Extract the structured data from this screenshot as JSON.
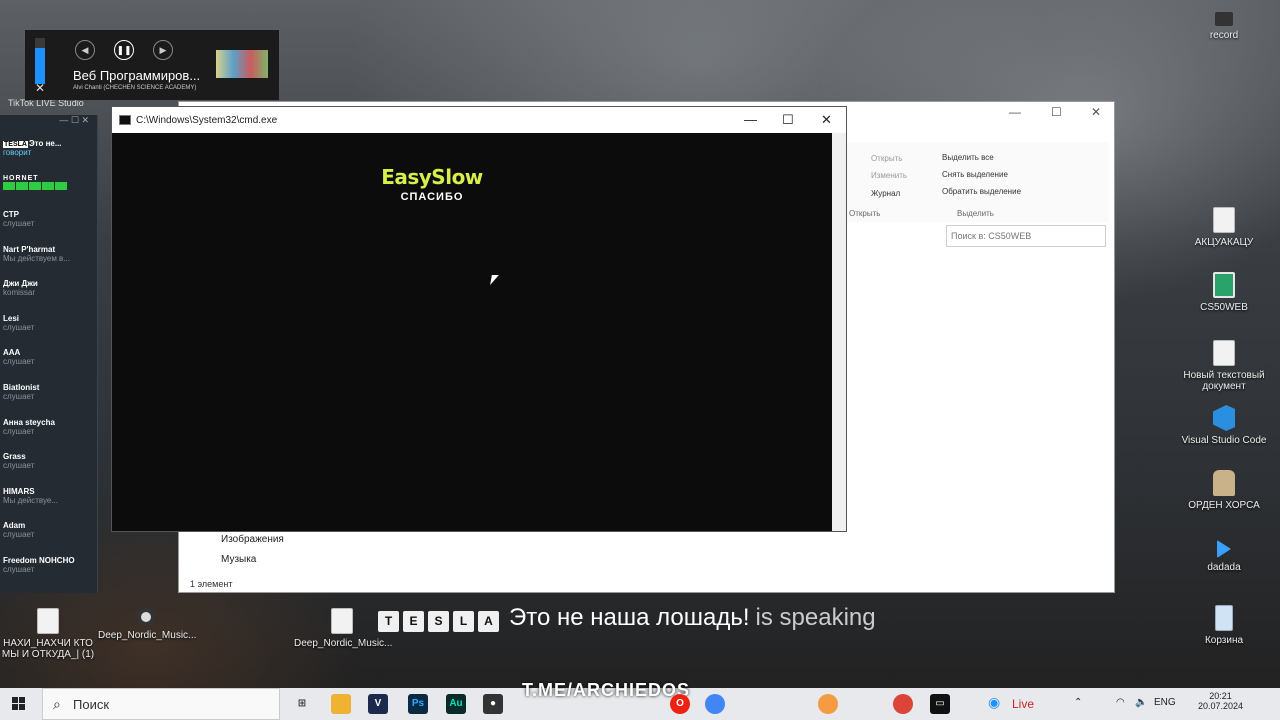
{
  "desktop": {
    "left_icons": [
      {
        "label": "NAXI_NAXCHI  KTO MY I OTKUDA_| (1)",
        "display": "НАХИ_НАХЧИ  КТО МЫ И ОТКУДА_| (1)"
      },
      {
        "label": "Deep_Nordic_Music...",
        "display": "Deep_Nordic_Music..."
      },
      {
        "label": "Deep_Nordic_Music...",
        "display": "Deep_Nordic_Music..."
      }
    ],
    "small_labels": {
      "tiktok": "TikTok LIVE Studio",
      "nakhi_short": "НАХЧИ  НАХЧИ  МЫ И ОТКУДА_"
    },
    "right_icons": [
      {
        "label": "record"
      },
      {
        "label": "АКЦУАКАЦУ"
      },
      {
        "label": "CS50WEB"
      },
      {
        "label": "Новый текстовый документ"
      },
      {
        "label": "Visual Studio Code"
      },
      {
        "label": "ОРДЕН ХОРСА"
      },
      {
        "label": "dadada"
      },
      {
        "label": "Корзина"
      }
    ]
  },
  "media_flyout": {
    "title": "Веб Программиров...",
    "artist": "Alvi Chanti (CHECHEN SCIENCE ACADEMY)",
    "volume_level": 0.78,
    "close_glyph": "✕"
  },
  "voice_panel": {
    "header_controls": "—  ☐  ✕",
    "speaker": {
      "tag_letters": [
        "T",
        "E",
        "S",
        "L",
        "A"
      ],
      "name": "Это не...",
      "status": "говорит"
    },
    "hornet_tag": "HORNET",
    "users": [
      {
        "name": "CTP",
        "status": "слушает"
      },
      {
        "name": "Nart P'harmat",
        "status": "Мы действуем в..."
      },
      {
        "name": "Джи Джи",
        "status": "komissar"
      },
      {
        "name": "Lesi",
        "status": "слушает"
      },
      {
        "name": "AAA",
        "status": "слушает"
      },
      {
        "name": "Biatlonist",
        "status": "слушает"
      },
      {
        "name": "Анна steycha",
        "status": "слушает"
      },
      {
        "name": "Grass",
        "status": "слушает"
      },
      {
        "name": "HIMARS",
        "status": "Мы действуе..."
      },
      {
        "name": "Adam",
        "status": "слушает"
      },
      {
        "name": "Freedom NOHCHO",
        "status": "слушает"
      }
    ]
  },
  "explorer": {
    "ribbon": {
      "open": "Открыть",
      "edit": "Изменить",
      "history": "Журнал",
      "open_group": "Открыть",
      "select_all": "Выделить все",
      "select_none": "Снять выделение",
      "invert": "Обратить выделение",
      "select_group": "Выделить"
    },
    "search_placeholder": "Поиск в: CS50WEB",
    "nav": [
      "Изображения",
      "Музыка"
    ],
    "status": "1 элемент",
    "controls": {
      "min": "—",
      "max": "☐",
      "close": "✕"
    }
  },
  "cmd": {
    "title": "C:\\Windows\\System32\\cmd.exe",
    "banner": "EasySlow",
    "subtitle": "СПАСИБО",
    "controls": {
      "min": "—",
      "max": "☐",
      "close": "✕"
    }
  },
  "speaking_banner": {
    "tag_letters": [
      "T",
      "E",
      "S",
      "L",
      "A"
    ],
    "name": "Это не наша лошадь!",
    "suffix": "is speaking"
  },
  "taskbar": {
    "search_label": "Поиск",
    "watermark": "T.ME/ARCHIEDOS",
    "live_label": "Live",
    "lang": "ENG",
    "time": "20:21",
    "date": "20.07.2024",
    "colors": {
      "taskbar_bg": "#e7e9ec",
      "accent": "#1e90ff"
    }
  }
}
